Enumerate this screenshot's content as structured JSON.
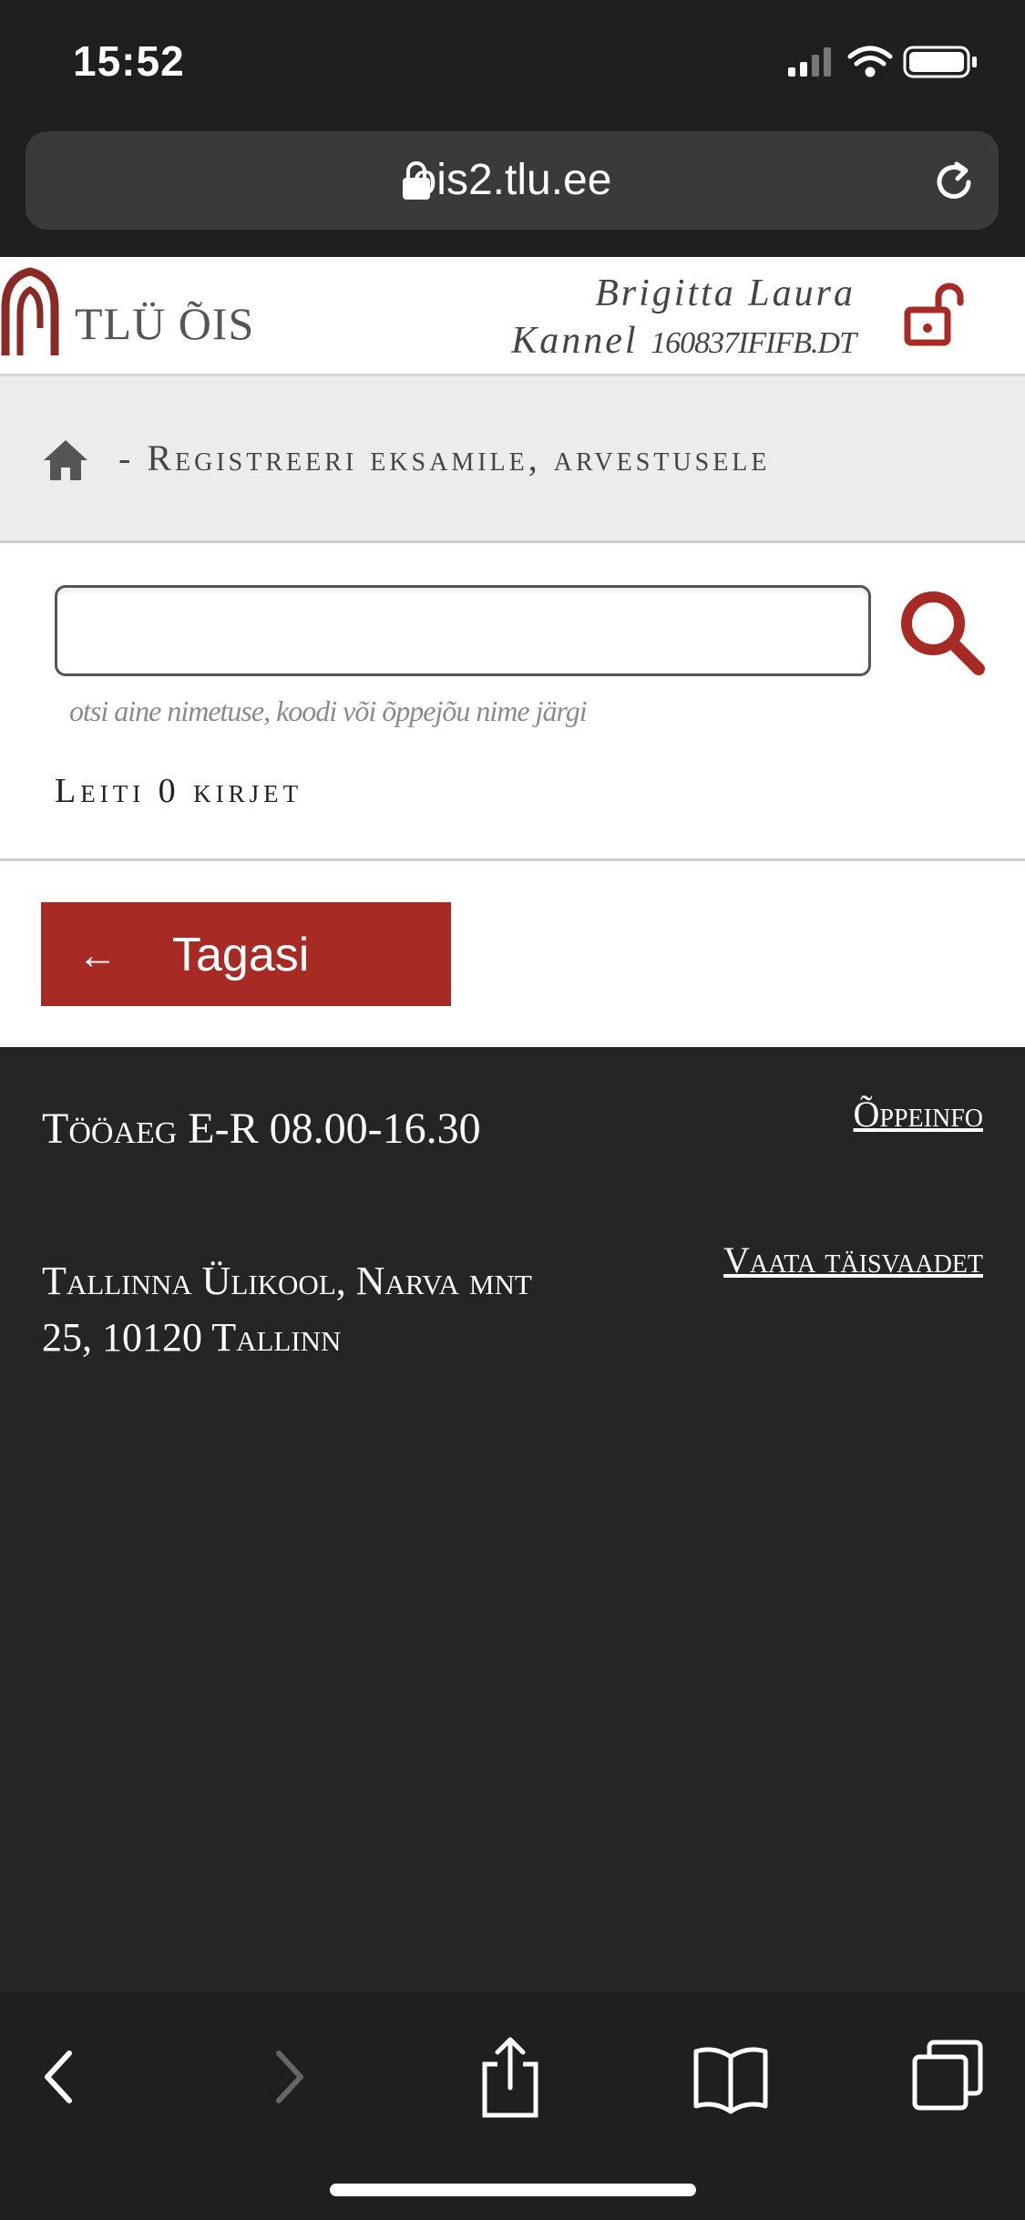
{
  "status_bar": {
    "time": "15:52"
  },
  "browser": {
    "url": "ois2.tlu.ee"
  },
  "header": {
    "logo_text": "TLÜ ÕIS",
    "user_line1": "Brigitta Laura",
    "user_line2_name": "Kannel",
    "user_code": "160837IFIFB.DT"
  },
  "breadcrumb": {
    "text": "- Registreeri eksamile, arvestusele"
  },
  "search": {
    "placeholder": "",
    "hint": "otsi aine nimetuse, koodi või õppejõu nime järgi",
    "result_count_text": "Leiti 0 kirjet"
  },
  "back_button": {
    "arrow": "←",
    "label": "Tagasi"
  },
  "footer": {
    "hours": "Tööaeg E-R 08.00-16.30",
    "address_line1": "Tallinna Ülikool, Narva mnt",
    "address_line2": "25, 10120 Tallinn",
    "link_info": "Õppeinfo",
    "link_full_view": "Vaata täisvaadet"
  },
  "colors": {
    "brand_red": "#a72a24",
    "footer_bg": "#252526",
    "toolbar_bg": "#1f1f1f"
  }
}
